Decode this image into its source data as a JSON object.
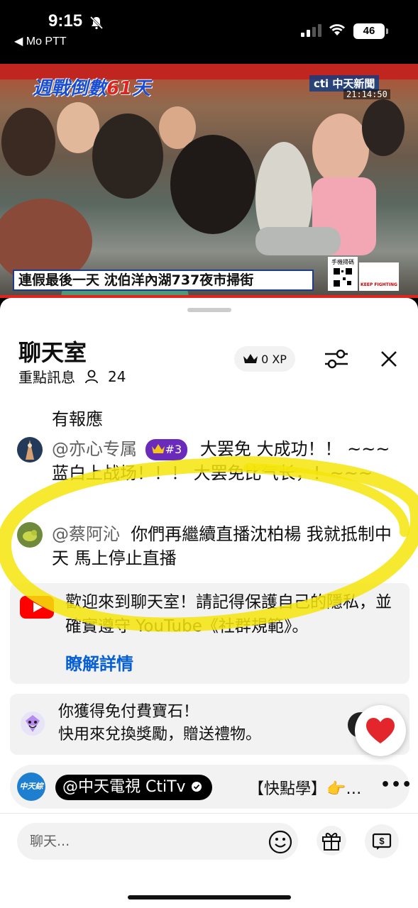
{
  "status_bar": {
    "time": "9:15",
    "back_label": "◀ Mo PTT",
    "battery": "46"
  },
  "video": {
    "banner": {
      "part1": "週戰",
      "part2": "倒數",
      "part3": "61",
      "part4": "天"
    },
    "channel_logo": "cti 中天新聞",
    "clock": "21:14:50",
    "caption": "連假最後一天 沈伯洋內湖737夜市掃街",
    "qr_label": "手機掃碼",
    "keep_label": "KEEP FIGHTING"
  },
  "chat": {
    "title": "聊天室",
    "subtitle": "重點訊息",
    "viewers": "24",
    "xp": "0 XP"
  },
  "messages": [
    {
      "author": "",
      "text": "有報應"
    },
    {
      "author": "@亦心专属",
      "badge": "#3",
      "text": "大罢免 大成功！！ ~~~ 蓝白上战场！！！   大罢免比气长，！~~~"
    },
    {
      "author": "@蔡阿沁",
      "text": "你們再繼續直播沈柏楊 我就抵制中天 馬上停止直播"
    }
  ],
  "welcome": {
    "text": "歡迎來到聊天室！請記得保護自己的隱私，並確實遵守 YouTube《社群規範》。",
    "link": "瞭解詳情"
  },
  "gems": {
    "line1": "你獲得免付費寶石！",
    "line2": "快用來兌換獎勵，贈送禮物。"
  },
  "pinned": {
    "avatar_text": "中天綜合",
    "channel": "@中天電視 CtiTv",
    "text": "【快點學】👉…"
  },
  "input": {
    "placeholder": "聊天..."
  },
  "colors": {
    "accent_link": "#065fd4",
    "badge_purple": "#6a2bbd",
    "highlight_yellow": "#f5e50a",
    "heart_red": "#e3262c"
  }
}
